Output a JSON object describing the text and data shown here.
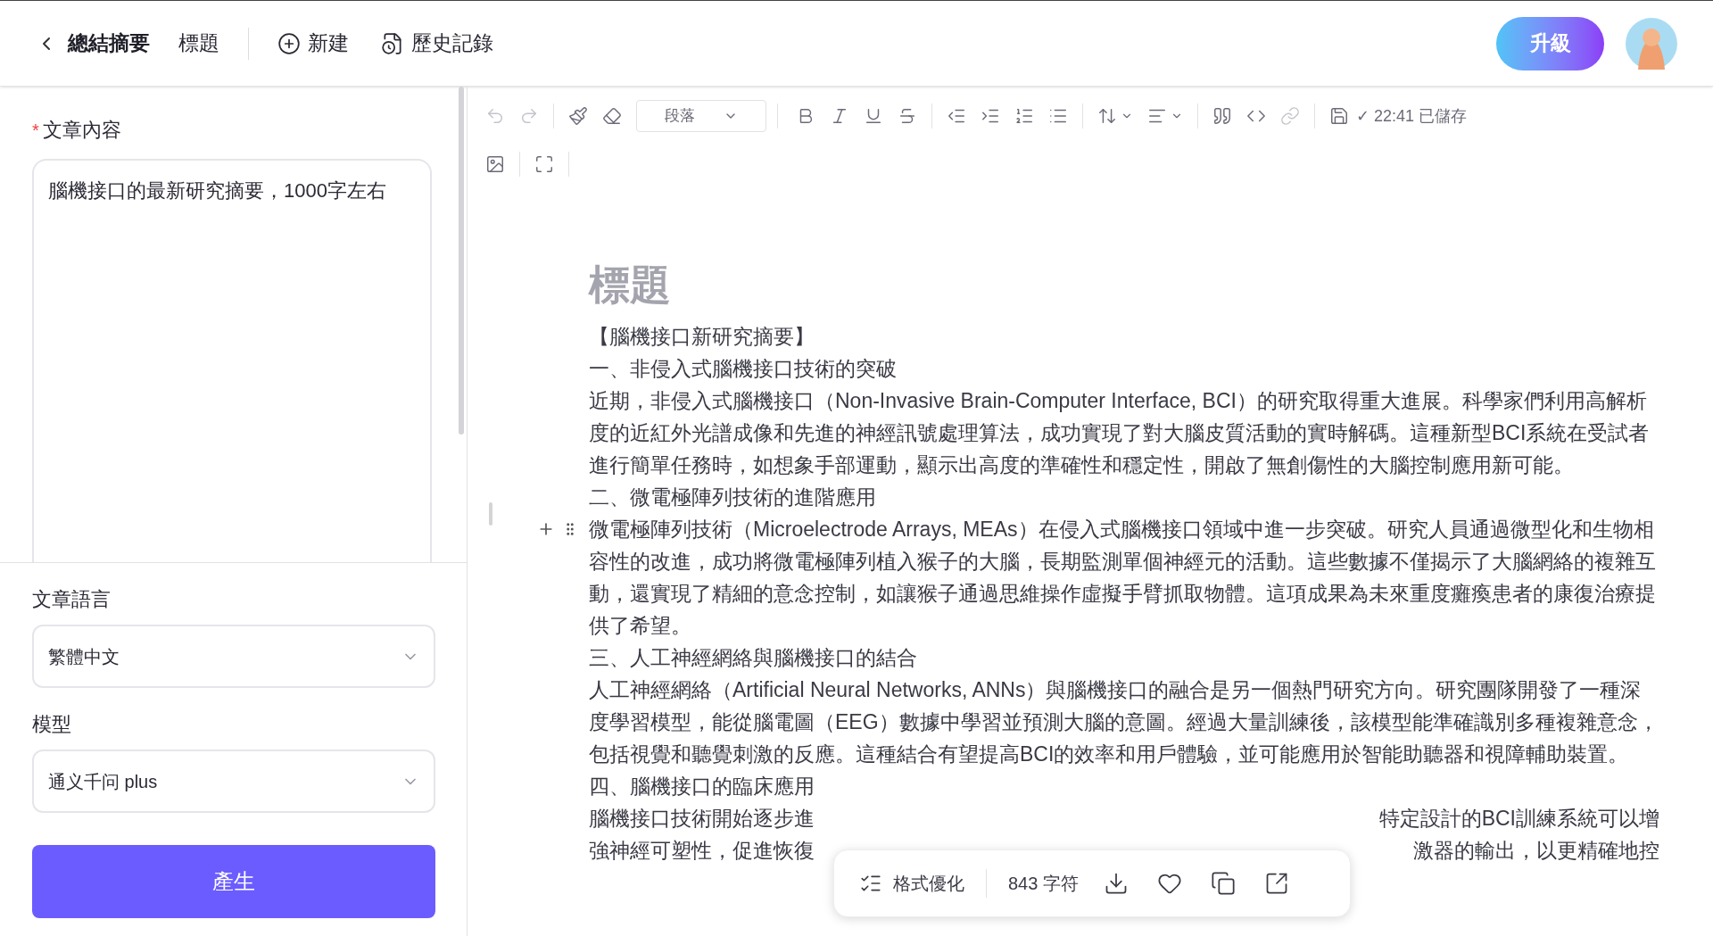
{
  "header": {
    "section": "總結摘要",
    "doc_title": "標題",
    "actions": [
      {
        "kind": "new",
        "label": "新建"
      },
      {
        "kind": "history",
        "label": "歷史記錄"
      }
    ],
    "upgrade": "升級"
  },
  "form": {
    "content_label": "文章內容",
    "required": true,
    "required_mark": "*",
    "content_value": "腦機接口的最新研究摘要，1000字左右",
    "language_label": "文章語言",
    "language_value": "繁體中文",
    "model_label": "模型",
    "model_value": "通义千问 plus",
    "generate": "產生"
  },
  "toolbar": {
    "block_style": "段落",
    "save_mark": "✓",
    "save_status": "22:41 已儲存"
  },
  "document": {
    "title": "標題",
    "blocks": [
      {
        "text": "【腦機接口新研究摘要】",
        "hovered": false
      },
      {
        "text": "一、非侵入式腦機接口技術的突破",
        "hovered": false
      },
      {
        "text": "近期，非侵入式腦機接口（Non-Invasive Brain-Computer Interface, BCI）的研究取得重大進展。科學家們利用高解析度的近紅外光譜成像和先進的神經訊號處理算法，成功實現了對大腦皮質活動的實時解碼。這種新型BCI系統在受試者進行簡單任務時，如想象手部運動，顯示出高度的準確性和穩定性，開啟了無創傷性的大腦控制應用新可能。",
        "hovered": false
      },
      {
        "text": "二、微電極陣列技術的進階應用",
        "hovered": false
      },
      {
        "text": "微電極陣列技術（Microelectrode Arrays, MEAs）在侵入式腦機接口領域中進一步突破。研究人員通過微型化和生物相容性的改進，成功將微電極陣列植入猴子的大腦，長期監測單個神經元的活動。這些數據不僅揭示了大腦網絡的複雜互動，還實現了精細的意念控制，如讓猴子通過思維操作虛擬手臂抓取物體。這項成果為未來重度癱瘓患者的康復治療提供了希望。",
        "hovered": true
      },
      {
        "text": "三、人工神經網絡與腦機接口的結合",
        "hovered": false
      },
      {
        "text": "人工神經網絡（Artificial Neural Networks, ANNs）與腦機接口的融合是另一個熱門研究方向。研究團隊開發了一種深度學習模型，能從腦電圖（EEG）數據中學習並預測大腦的意圖。經過大量訓練後，該模型能準確識別多種複雜意念，包括視覺和聽覺刺激的反應。這種結合有望提高BCI的效率和用戶體驗，並可能應用於智能助聽器和視障輔助裝置。",
        "hovered": false
      },
      {
        "text": "四、腦機接口的臨床應用",
        "hovered": false
      }
    ],
    "covered_line": {
      "before": "腦機接口技術開始逐步進",
      "after": "特定設計的BCI訓練系統可以增"
    },
    "last_line": {
      "before": "強神經可塑性，促進恢復",
      "after": "激器的輸出，以更精確地控"
    }
  },
  "floating_bar": {
    "format": "格式優化",
    "count": "843 字符"
  }
}
